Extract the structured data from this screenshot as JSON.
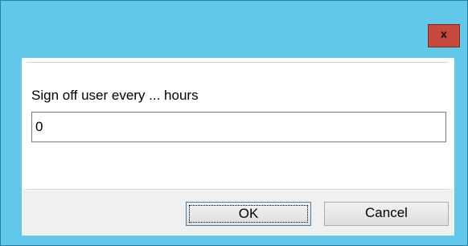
{
  "title_bar": {
    "close_label": "x"
  },
  "dialog": {
    "prompt": "Sign off user every ... hours",
    "input_value": "0"
  },
  "buttons": {
    "ok_label": "OK",
    "cancel_label": "Cancel"
  },
  "colors": {
    "frame": "#62c8ea",
    "close_button": "#c7493b",
    "button_area": "#f0f0f0"
  },
  "icons": {
    "close": "close-icon"
  }
}
